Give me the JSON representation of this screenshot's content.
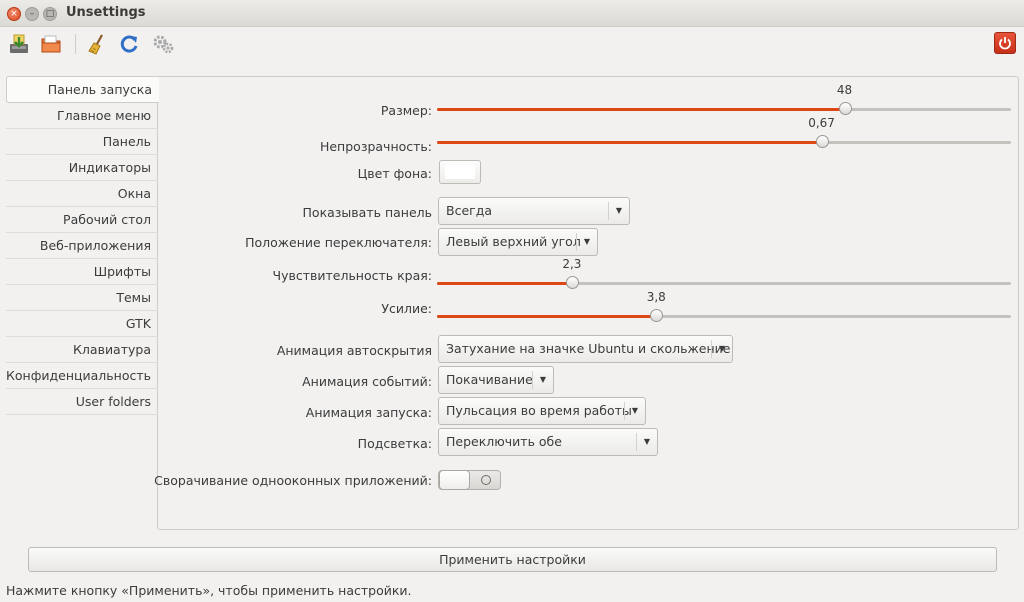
{
  "window": {
    "title": "Unsettings",
    "close_glyph": "×",
    "min_glyph": "–",
    "max_glyph": "□"
  },
  "toolbar": {
    "icons": [
      "import-icon",
      "export-icon",
      "broom-icon",
      "refresh-icon",
      "gears-icon"
    ],
    "power_icon": "power-icon"
  },
  "tabs": [
    "Панель запуска",
    "Главное меню",
    "Панель",
    "Индикаторы",
    "Окна",
    "Рабочий стол",
    "Веб-приложения",
    "Шрифты",
    "Темы",
    "GTK",
    "Клавиатура",
    "Конфиденциальность",
    "User folders"
  ],
  "settings": {
    "size": {
      "label": "Размер:",
      "value": "48",
      "fraction": 0.71
    },
    "opacity": {
      "label": "Непрозрачность:",
      "value": "0,67",
      "fraction": 0.67
    },
    "bg_color": {
      "label": "Цвет фона:",
      "color": "#ffffff"
    },
    "show_panel": {
      "label": "Показывать панель",
      "selected": "Всегда"
    },
    "switcher_pos": {
      "label": "Положение переключателя:",
      "selected": "Левый верхний угол"
    },
    "edge_sensitivity": {
      "label": "Чувствительность края:",
      "value": "2,3",
      "fraction": 0.235
    },
    "pressure": {
      "label": "Усилие:",
      "value": "3,8",
      "fraction": 0.382
    },
    "autohide_anim": {
      "label": "Анимация автоскрытия",
      "selected": "Затухание на значке Ubuntu и скольжение"
    },
    "event_anim": {
      "label": "Анимация событий:",
      "selected": "Покачивание"
    },
    "launch_anim": {
      "label": "Анимация запуска:",
      "selected": "Пульсация во время работы"
    },
    "highlight": {
      "label": "Подсветка:",
      "selected": "Переключить обе"
    },
    "minimize_single": {
      "label": "Сворачивание однооконных приложений:",
      "on": false
    }
  },
  "apply_button": "Применить настройки",
  "status": "Нажмите кнопку «Применить», чтобы применить настройки.",
  "colors": {
    "accent": "#dd4814",
    "power": "#d9411f"
  }
}
